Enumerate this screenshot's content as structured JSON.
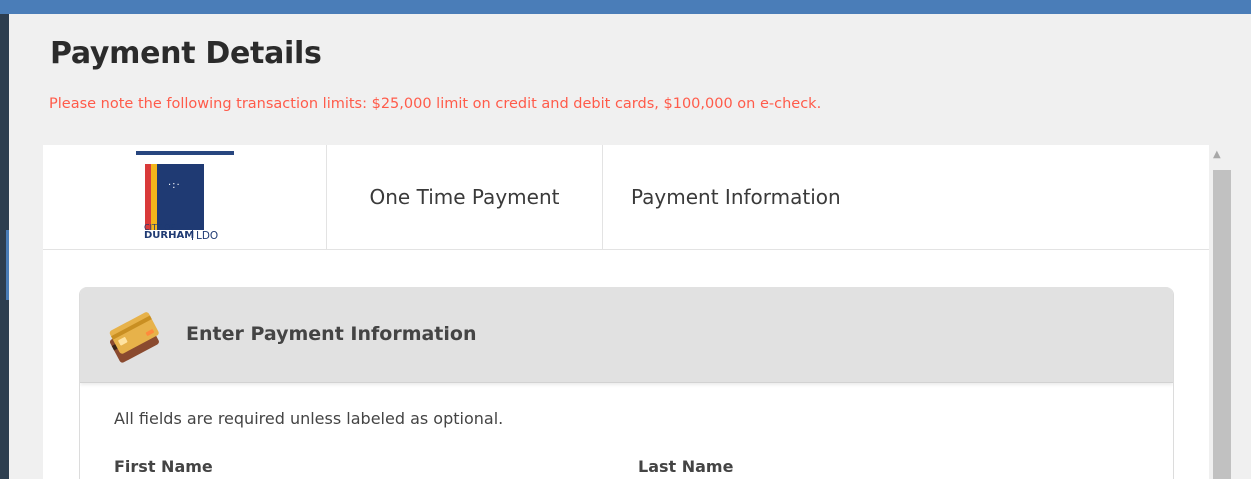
{
  "page": {
    "title": "Payment Details",
    "notice": "Please note the following transaction limits: $25,000 limit on credit and debit cards, $100,000 on e-check."
  },
  "header": {
    "logo": {
      "line1": "CITY OF",
      "line2": "DURHAM",
      "suffix": "LDO"
    },
    "steps": [
      {
        "label": "One Time Payment"
      },
      {
        "label": "Payment Information"
      }
    ]
  },
  "card": {
    "icon": "credit-card-icon",
    "title": "Enter Payment Information",
    "required_note": "All fields are required unless labeled as optional.",
    "fields": [
      {
        "label": "First Name"
      },
      {
        "label": "Last Name"
      }
    ]
  },
  "colors": {
    "top_bar": "#4a7db8",
    "left_rail": "#2d3e50",
    "notice": "#ff5b4a",
    "card_header": "#e1e1e1",
    "logo_navy": "#1f3a73"
  }
}
